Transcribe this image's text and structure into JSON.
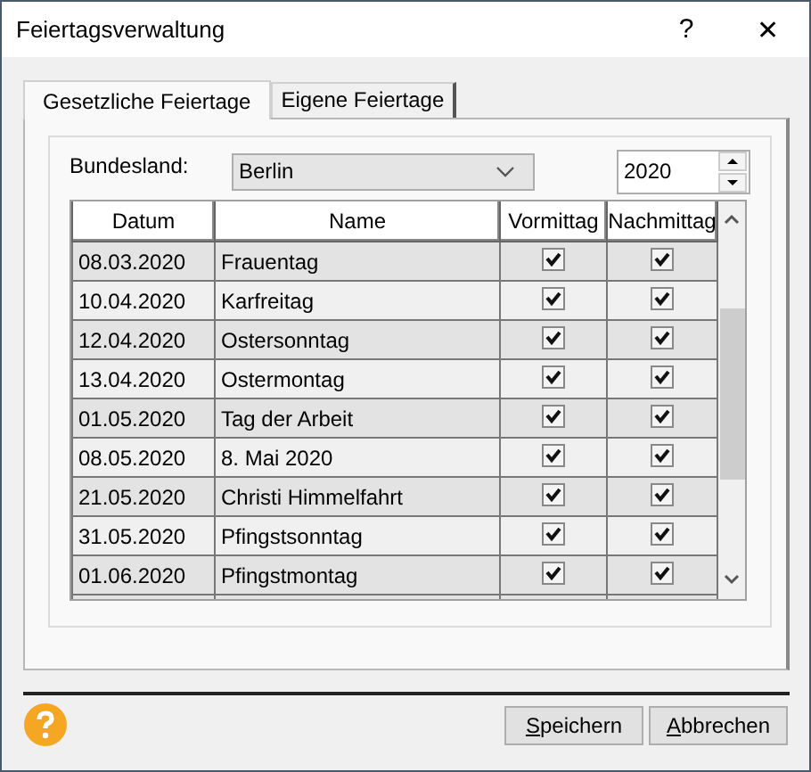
{
  "window": {
    "title": "Feiertagsverwaltung",
    "help_glyph": "?",
    "close_glyph": "✕"
  },
  "tabs": [
    {
      "label": "Gesetzliche Feiertage",
      "selected": true
    },
    {
      "label": "Eigene Feiertage",
      "selected": false
    }
  ],
  "bundesland": {
    "label": "Bundesland:",
    "value": "Berlin"
  },
  "year": {
    "value": "2020"
  },
  "table": {
    "columns": [
      "Datum",
      "Name",
      "Vormittag",
      "Nachmittag"
    ],
    "rows": [
      {
        "date": "08.03.2020",
        "name": "Frauentag",
        "morning": true,
        "afternoon": true
      },
      {
        "date": "10.04.2020",
        "name": "Karfreitag",
        "morning": true,
        "afternoon": true
      },
      {
        "date": "12.04.2020",
        "name": "Ostersonntag",
        "morning": true,
        "afternoon": true
      },
      {
        "date": "13.04.2020",
        "name": "Ostermontag",
        "morning": true,
        "afternoon": true
      },
      {
        "date": "01.05.2020",
        "name": "Tag der Arbeit",
        "morning": true,
        "afternoon": true
      },
      {
        "date": "08.05.2020",
        "name": "8. Mai 2020",
        "morning": true,
        "afternoon": true
      },
      {
        "date": "21.05.2020",
        "name": "Christi Himmelfahrt",
        "morning": true,
        "afternoon": true
      },
      {
        "date": "31.05.2020",
        "name": "Pfingstsonntag",
        "morning": true,
        "afternoon": true
      },
      {
        "date": "01.06.2020",
        "name": "Pfingstmontag",
        "morning": true,
        "afternoon": true
      }
    ]
  },
  "buttons": [
    {
      "label": "Speichern"
    },
    {
      "label": "Abbrechen"
    }
  ]
}
